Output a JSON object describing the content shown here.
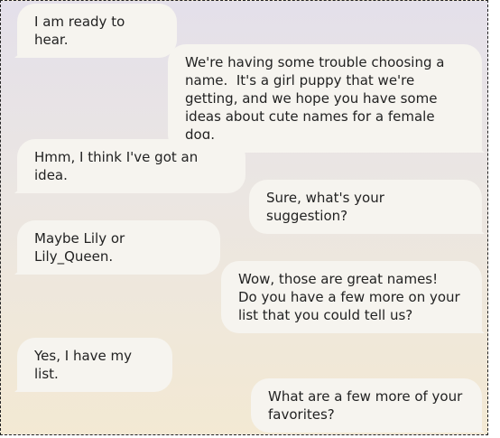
{
  "conversation": {
    "messages": [
      {
        "side": "left",
        "text": "I am ready to hear."
      },
      {
        "side": "right",
        "text": "We're having some trouble choosing a name.  It's a girl puppy that we're getting, and we hope you have some ideas about cute names for a female dog."
      },
      {
        "side": "left",
        "text": "Hmm, I think I've got an idea."
      },
      {
        "side": "right",
        "text": "Sure, what's your suggestion?"
      },
      {
        "side": "left",
        "text": "Maybe Lily or Lily_Queen."
      },
      {
        "side": "right",
        "text": "Wow, those are great names!  Do you have a few more on your list that you could tell us?"
      },
      {
        "side": "left",
        "text": "Yes, I have my list."
      },
      {
        "side": "right",
        "text": "What are a few more of your favorites?"
      }
    ]
  }
}
